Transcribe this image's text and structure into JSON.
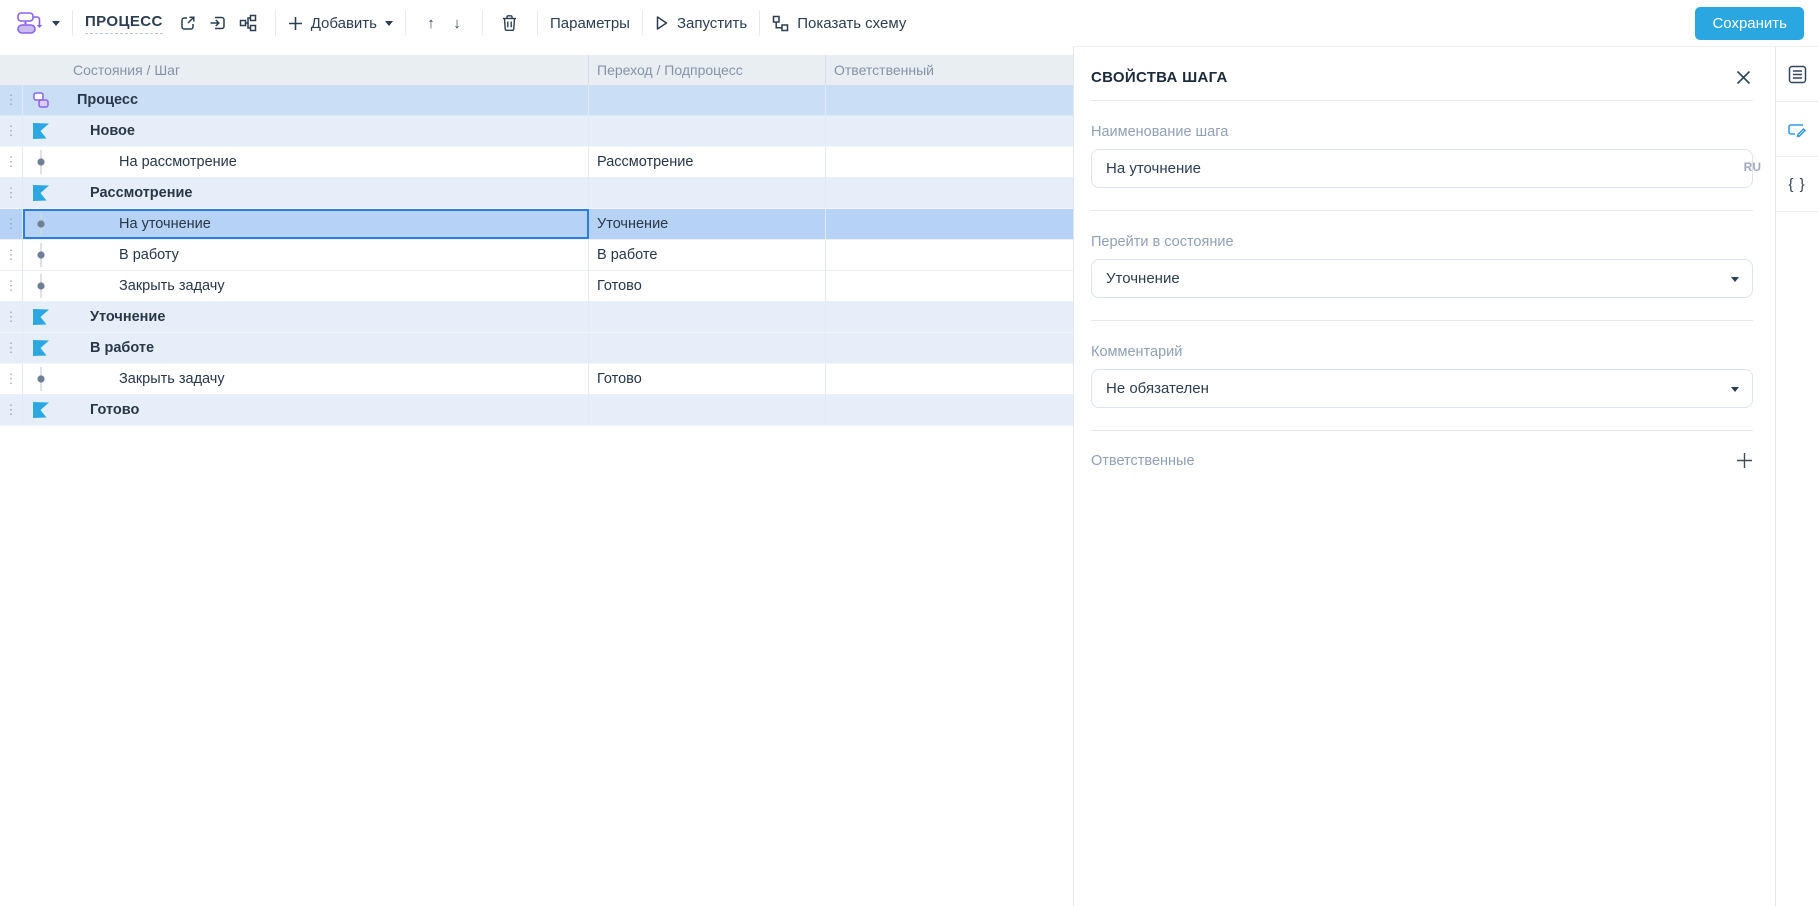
{
  "toolbar": {
    "process_label": "ПРОЦЕСС",
    "add_label": "Добавить",
    "params_label": "Параметры",
    "run_label": "Запустить",
    "show_schema_label": "Показать схему",
    "save_label": "Сохранить"
  },
  "table": {
    "columns": [
      "Состояния / Шаг",
      "Переход / Подпроцесс",
      "Ответственный"
    ],
    "rows": [
      {
        "type": "process",
        "name": "Процесс",
        "transition": "",
        "responsible": ""
      },
      {
        "type": "state",
        "name": "Новое",
        "transition": "",
        "responsible": ""
      },
      {
        "type": "step",
        "name": "На рассмотрение",
        "transition": "Рассмотрение",
        "responsible": ""
      },
      {
        "type": "state",
        "name": "Рассмотрение",
        "transition": "",
        "responsible": ""
      },
      {
        "type": "step",
        "name": "На уточнение",
        "transition": "Уточнение",
        "responsible": "",
        "selected": true
      },
      {
        "type": "step",
        "name": "В работу",
        "transition": "В работе",
        "responsible": ""
      },
      {
        "type": "step",
        "name": "Закрыть задачу",
        "transition": "Готово",
        "responsible": ""
      },
      {
        "type": "state",
        "name": "Уточнение",
        "transition": "",
        "responsible": ""
      },
      {
        "type": "state",
        "name": "В работе",
        "transition": "",
        "responsible": ""
      },
      {
        "type": "step",
        "name": "Закрыть задачу",
        "transition": "Готово",
        "responsible": ""
      },
      {
        "type": "state",
        "name": "Готово",
        "transition": "",
        "responsible": ""
      }
    ]
  },
  "panel": {
    "title": "СВОЙСТВА ШАГА",
    "name_label": "Наименование шага",
    "name_value": "На уточнение",
    "lang_badge": "RU",
    "state_label": "Перейти в состояние",
    "state_value": "Уточнение",
    "comment_label": "Комментарий",
    "comment_value": "Не обязателен",
    "responsible_label": "Ответственные"
  },
  "icons": {
    "drag_handle": "⋮",
    "braces": "{ }",
    "arrow_up": "↑",
    "arrow_down": "↓"
  },
  "colors": {
    "accent-blue": "#2aa6e0",
    "selection-border": "#2b7de0",
    "selection-bg": "#b6d3f6",
    "process-row-bg": "#cadef5",
    "state-row-bg": "#e6eefa",
    "flag-blue": "#2da7e2",
    "icon-purple": "#8a63e8",
    "header-bg": "#e9eef3",
    "text-dark": "#2c3e50",
    "label-gray": "#90a0b5"
  }
}
